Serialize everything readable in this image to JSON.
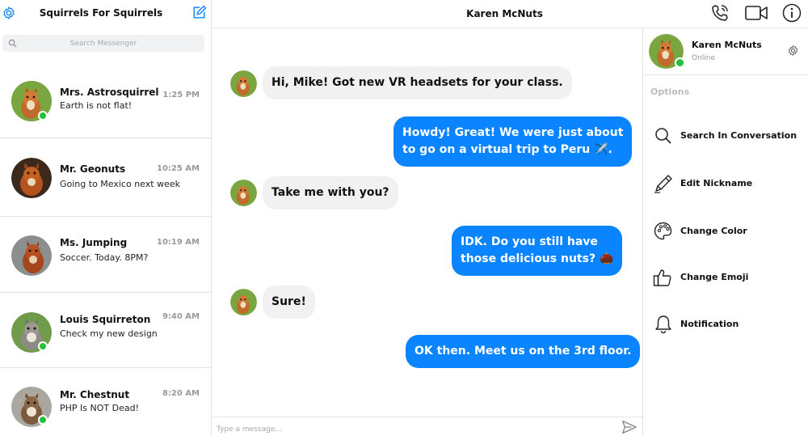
{
  "sidebar": {
    "title": "Squirrels For Squirrels",
    "search_placeholder": "Search Messenger",
    "conversations": [
      {
        "name": "Mrs. Astrosquirrel",
        "message": "Earth is not flat!",
        "time": "1:25 PM",
        "online": true
      },
      {
        "name": "Mr. Geonuts",
        "message": "Going to Mexico next week",
        "time": "10:25 AM",
        "online": false
      },
      {
        "name": "Ms. Jumping",
        "message": "Soccer. Today. 8PM?",
        "time": "10:19 AM",
        "online": false
      },
      {
        "name": "Louis Squirreton",
        "message": "Check my new design",
        "time": "9:40 AM",
        "online": true
      },
      {
        "name": "Mr. Chestnut",
        "message": "PHP Is NOT Dead!",
        "time": "8:20 AM",
        "online": true
      }
    ]
  },
  "chat": {
    "contact_name": "Karen McNuts",
    "messages": [
      {
        "direction": "in",
        "text": "Hi, Mike! Got new VR headsets for your class."
      },
      {
        "direction": "out",
        "line1": "Howdy! Great! We were just about",
        "line2": "to go on a virtual trip to Peru ✈️."
      },
      {
        "direction": "in",
        "text": "Take me with you?"
      },
      {
        "direction": "out",
        "line1": "IDK. Do you still have",
        "line2": "those delicious nuts? 🌰"
      },
      {
        "direction": "in",
        "text": "Sure!"
      },
      {
        "direction": "out",
        "text": "OK then. Meet us on the 3rd floor."
      }
    ],
    "composer_placeholder": "Type a message..."
  },
  "profile": {
    "name": "Karen McNuts",
    "status": "Online",
    "options_label": "Options",
    "options": [
      {
        "label": "Search In Conversation",
        "icon": "search-icon"
      },
      {
        "label": "Edit Nickname",
        "icon": "pencil-icon"
      },
      {
        "label": "Change Color",
        "icon": "palette-icon"
      },
      {
        "label": "Change Emoji",
        "icon": "thumbs-up-icon"
      },
      {
        "label": "Notification",
        "icon": "bell-icon"
      }
    ]
  },
  "colors": {
    "accent": "#0b84ff",
    "online": "#25c03a",
    "incoming_bubble": "#f1f1f1",
    "outgoing_bubble": "#0b84ff"
  }
}
